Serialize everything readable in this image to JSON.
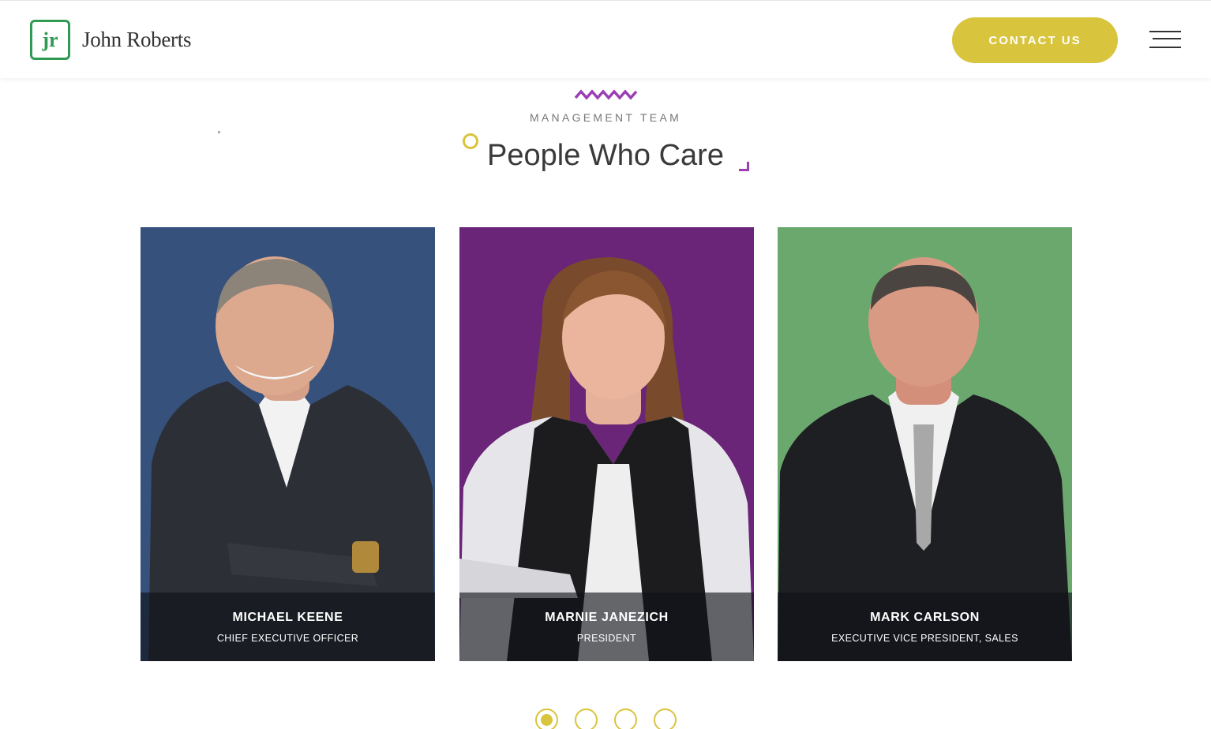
{
  "header": {
    "logo_mark": "jr",
    "logo_text": "John Roberts",
    "contact_label": "CONTACT US",
    "menu_icon": "hamburger-menu-icon"
  },
  "section": {
    "eyebrow": "MANAGEMENT TEAM",
    "title": "People Who Care"
  },
  "team": [
    {
      "name": "MICHAEL KEENE",
      "role": "CHIEF EXECUTIVE OFFICER",
      "bg_color": "#35517c"
    },
    {
      "name": "MARNIE JANEZICH",
      "role": "PRESIDENT",
      "bg_color": "#6a2478"
    },
    {
      "name": "MARK CARLSON",
      "role": "EXECUTIVE VICE PRESIDENT, SALES",
      "bg_color": "#6aa86e"
    }
  ],
  "carousel": {
    "page_count": 4,
    "active_page": 1
  },
  "colors": {
    "accent_yellow": "#d9c43d",
    "accent_purple": "#9a3fb4",
    "brand_green": "#2e9a52"
  }
}
